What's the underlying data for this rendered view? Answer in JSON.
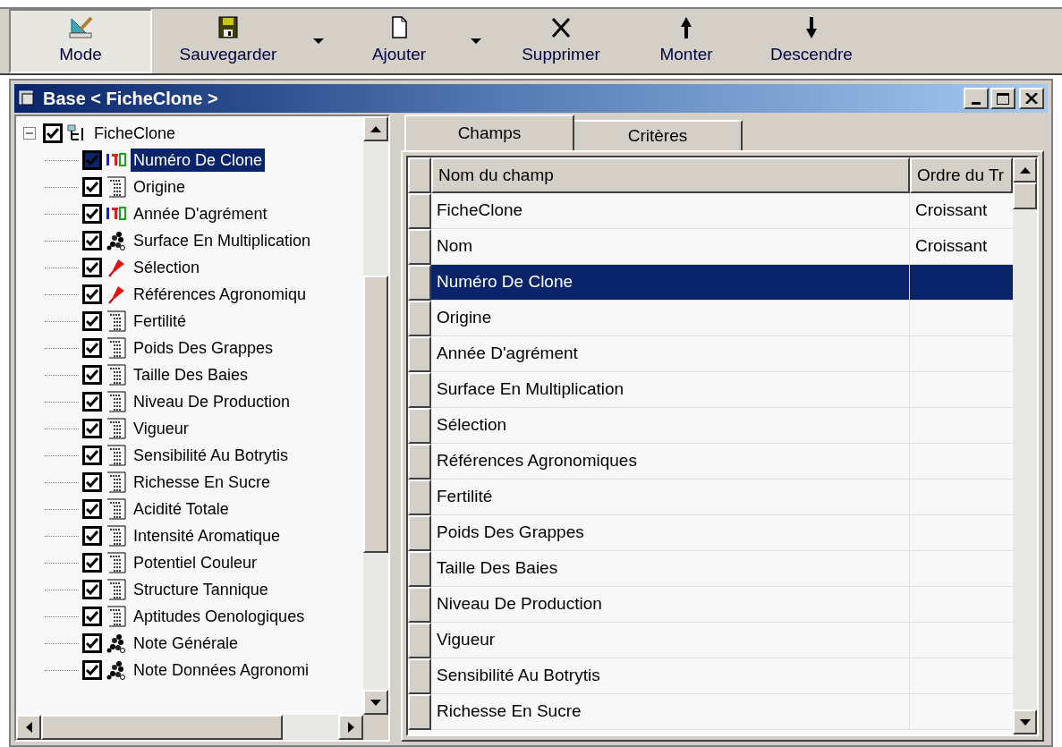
{
  "toolbar": [
    {
      "label": "Mode",
      "kind": "mode",
      "pressed": true,
      "has_dropdown": false
    },
    {
      "label": "Sauvegarder",
      "kind": "save",
      "pressed": false,
      "has_dropdown": true
    },
    {
      "label": "Ajouter",
      "kind": "add",
      "pressed": false,
      "has_dropdown": true
    },
    {
      "label": "Supprimer",
      "kind": "delete",
      "pressed": false,
      "has_dropdown": false
    },
    {
      "label": "Monter",
      "kind": "up",
      "pressed": false,
      "has_dropdown": false
    },
    {
      "label": "Descendre",
      "kind": "down",
      "pressed": false,
      "has_dropdown": false
    }
  ],
  "window": {
    "title": "Base < FicheClone >"
  },
  "tree": [
    {
      "label": "FicheClone",
      "kind": "table",
      "checked": true,
      "expanded": true,
      "selected": false,
      "children": [
        {
          "label": "Numéro De Clone",
          "kind": "number",
          "checked": true,
          "selected": true
        },
        {
          "label": "Origine",
          "kind": "text",
          "checked": true,
          "selected": false
        },
        {
          "label": "Année D'agrément",
          "kind": "number",
          "checked": true,
          "selected": false
        },
        {
          "label": "Surface En Multiplication",
          "kind": "cluster",
          "checked": true,
          "selected": false
        },
        {
          "label": "Sélection",
          "kind": "pin",
          "checked": true,
          "selected": false
        },
        {
          "label": "Références Agronomiqu",
          "kind": "pin",
          "checked": true,
          "selected": false
        },
        {
          "label": "Fertilité",
          "kind": "text",
          "checked": true,
          "selected": false
        },
        {
          "label": "Poids Des Grappes",
          "kind": "text",
          "checked": true,
          "selected": false
        },
        {
          "label": "Taille Des Baies",
          "kind": "text",
          "checked": true,
          "selected": false
        },
        {
          "label": "Niveau De Production",
          "kind": "text",
          "checked": true,
          "selected": false
        },
        {
          "label": "Vigueur",
          "kind": "text",
          "checked": true,
          "selected": false
        },
        {
          "label": "Sensibilité Au Botrytis",
          "kind": "text",
          "checked": true,
          "selected": false
        },
        {
          "label": "Richesse En Sucre",
          "kind": "text",
          "checked": true,
          "selected": false
        },
        {
          "label": "Acidité Totale",
          "kind": "text",
          "checked": true,
          "selected": false
        },
        {
          "label": "Intensité Aromatique",
          "kind": "text",
          "checked": true,
          "selected": false
        },
        {
          "label": "Potentiel Couleur",
          "kind": "text",
          "checked": true,
          "selected": false
        },
        {
          "label": "Structure Tannique",
          "kind": "text",
          "checked": true,
          "selected": false
        },
        {
          "label": "Aptitudes Oenologiques",
          "kind": "text",
          "checked": true,
          "selected": false
        },
        {
          "label": "Note Générale",
          "kind": "cluster",
          "checked": true,
          "selected": false
        },
        {
          "label": "Note Données Agronomi",
          "kind": "cluster",
          "checked": true,
          "selected": false
        }
      ]
    }
  ],
  "tabs": [
    {
      "label": "Champs",
      "selected": true
    },
    {
      "label": "Critères",
      "selected": false
    }
  ],
  "table": {
    "columns": [
      "Nom du champ",
      "Ordre du Tr"
    ],
    "rows": [
      {
        "field": "FicheClone",
        "order": "Croissant",
        "selected": false
      },
      {
        "field": "Nom",
        "order": "Croissant",
        "selected": false
      },
      {
        "field": "Numéro De Clone",
        "selected": true
      },
      {
        "field": "Origine",
        "selected": false
      },
      {
        "field": "Année D'agrément",
        "selected": false
      },
      {
        "field": "Surface En Multiplication",
        "selected": false
      },
      {
        "field": "Sélection",
        "selected": false
      },
      {
        "field": "Références Agronomiques",
        "selected": false
      },
      {
        "field": "Fertilité",
        "selected": false
      },
      {
        "field": "Poids Des Grappes",
        "selected": false
      },
      {
        "field": "Taille Des Baies",
        "selected": false
      },
      {
        "field": "Niveau De Production",
        "selected": false
      },
      {
        "field": "Vigueur",
        "selected": false
      },
      {
        "field": "Sensibilité Au Botrytis",
        "selected": false
      },
      {
        "field": "Richesse En Sucre",
        "selected": false
      }
    ]
  }
}
